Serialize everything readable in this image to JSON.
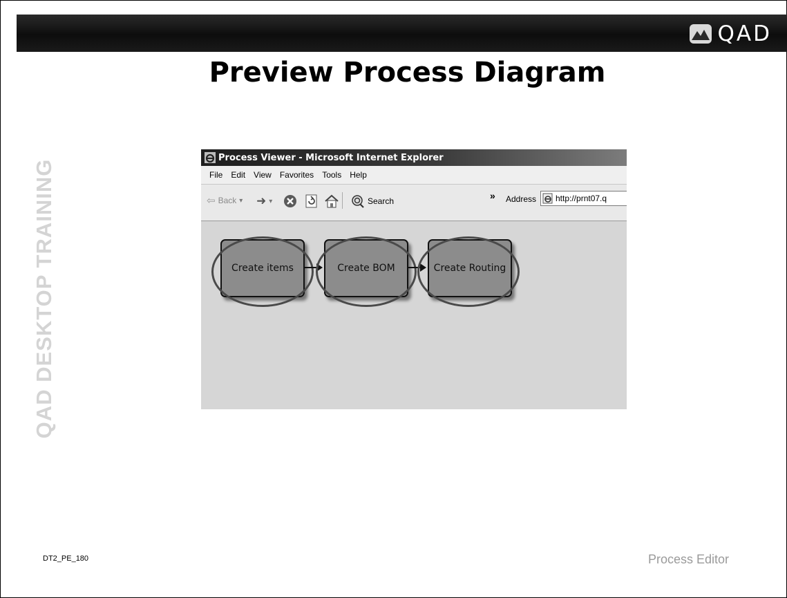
{
  "brand": {
    "logo_text": "QAD",
    "side_label": "QAD DESKTOP TRAINING"
  },
  "slide": {
    "title": "Preview Process Diagram",
    "code": "DT2_PE_180",
    "section": "Process Editor"
  },
  "browser": {
    "window_title": "Process Viewer - Microsoft Internet Explorer",
    "menu": [
      "File",
      "Edit",
      "View",
      "Favorites",
      "Tools",
      "Help"
    ],
    "toolbar": {
      "back_label": "Back",
      "search_label": "Search",
      "chevron": "»",
      "address_label": "Address",
      "address_value": "http://prnt07.q"
    }
  },
  "diagram": {
    "nodes": [
      {
        "label": "Create items"
      },
      {
        "label": "Create BOM"
      },
      {
        "label": "Create Routing"
      }
    ]
  }
}
